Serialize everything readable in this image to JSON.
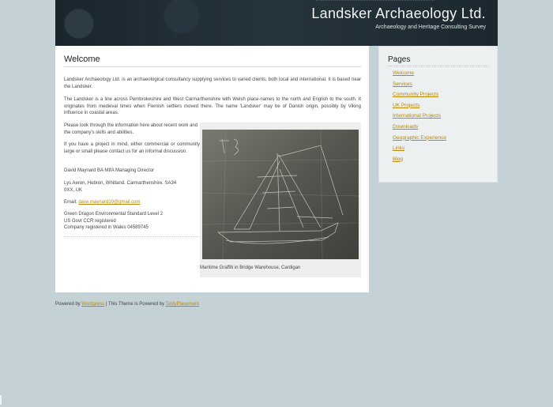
{
  "header": {
    "title": "Landsker Archaeology Ltd.",
    "tagline": "Archaeology and Heritage Consulting Survey"
  },
  "main": {
    "heading": "Welcome",
    "paragraphs": [
      "Landsker Archaeology Ltd. is an archaeological consultancy supplying services to varied clients, both local and international. It is based near the Landsker.",
      "The Landsker is a line across Pembrokeshire and West Carmarthenshire with Welsh place-names to the north and English to the south. It originates from medieval times when Flemish settlers moved there. The name 'Landsker' may be of Danish origin, possibly by Viking influence in coastal areas.",
      "Please look through the information here about recent work and the company's skills and abilities.",
      "If you have a project in mind, either commercial or community large or small please contact us for an informal discussion."
    ],
    "contact_name": "David Maynard BA MIfA Managing Director",
    "address_line1": "Lys Aeron, Hebron, Whitland. Carmarthenshire. SA34",
    "address_line2": "0XX, UK",
    "email_label": "Email:",
    "email": "dave.maynard10@gmail.com",
    "accreditations": [
      "Green Dragon Environmental Standard Level 2",
      "US Govt CCR registered",
      "Company registered in Wales 04589745"
    ],
    "figure": {
      "caption": "Maritime Graffiti in Bridge Warehouse, Cardigan"
    }
  },
  "sidebar": {
    "heading": "Pages",
    "items": [
      {
        "label": "Welcome"
      },
      {
        "label": "Services"
      },
      {
        "label": "Community Projects"
      },
      {
        "label": "UK Projects"
      },
      {
        "label": "International Projects"
      },
      {
        "label": "Downloads"
      },
      {
        "label": "Geographic Experience"
      },
      {
        "label": "Links"
      },
      {
        "label": "Blog"
      }
    ]
  },
  "footer": {
    "powered_by": "Powered by",
    "wordpress": "Wordpress",
    "separator": " | This Theme is Powered by ",
    "theme_credit": "TastyPlacement"
  },
  "colors": {
    "link": "#b8860b",
    "header_bg": "#1e2b33",
    "page_bg": "#c5d2d5"
  }
}
